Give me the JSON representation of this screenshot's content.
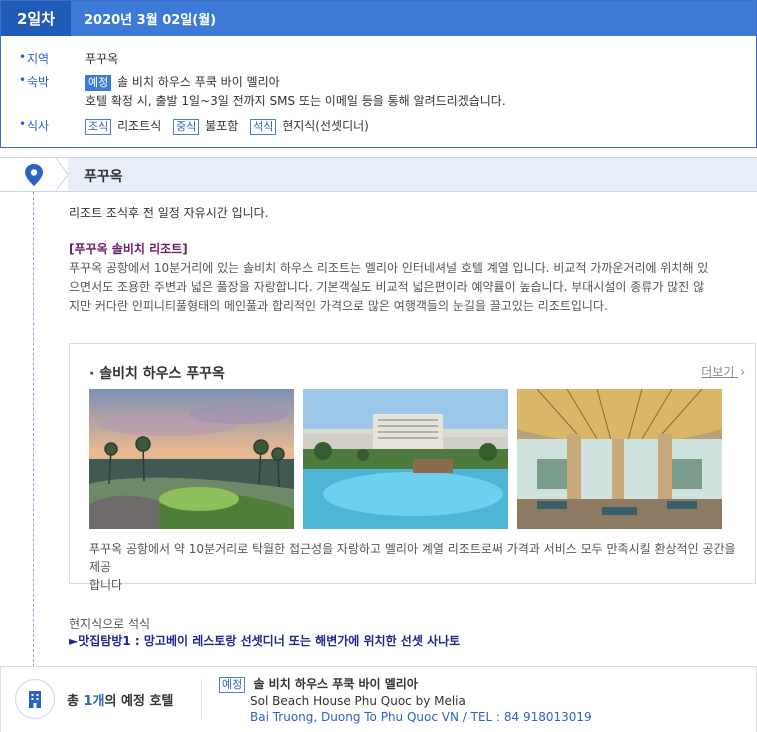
{
  "day": {
    "badge": "2일차",
    "date": "2020년 3월 02일(월)",
    "region_label": "지역",
    "region_value": "푸꾸옥",
    "stay_label": "숙박",
    "stay_tag": "예정",
    "stay_hotel": "솔 비치 하우스 푸쿡 바이 멜리아",
    "stay_note": "호텔 확정 시, 출발 1일~3일 전까지 SMS 또는 이메일 등을 통해 알려드리겠습니다.",
    "meal_label": "식사",
    "meals": [
      {
        "tag": "조식",
        "value": "리조트식"
      },
      {
        "tag": "중식",
        "value": "불포함"
      },
      {
        "tag": "석식",
        "value": "현지식(선셋디너)"
      }
    ]
  },
  "location": {
    "name": "푸꾸옥"
  },
  "schedule": {
    "free_time": "리조트 조식후 전 일정 자유시간 입니다.",
    "resort_title": "[푸꾸옥 솔비치 리조트]",
    "resort_desc_lines": [
      "푸꾸옥 공항에서 10분거리에 있는 솔비치 하우스 리조트는 멜리아 인터네셔널 호텔 계열 입니다. 비교적 가까운거리에 위치해 있",
      "으면서도 조용한 주변과 넓은 풀장을 자랑합니다. 기본객실도 비교적 넓은편이라 예약률이 높습니다. 부대시설이 종류가 많진 않",
      "지만 커다란 인피니티풀형태의 메인풀과 합리적인 가격으로 많은 여행객들의 눈길을 끌고있는 리조트입니다."
    ]
  },
  "hotel_card": {
    "title": "· 솔비치 하우스 푸꾸옥",
    "more": "더보기",
    "photos": [
      {
        "icon": "resort-sunset-photo"
      },
      {
        "icon": "resort-pool-photo"
      },
      {
        "icon": "resort-lobby-photo"
      }
    ],
    "desc_lines": [
      "푸꾸옥 공항에서 약 10분거리로 탁월한 접근성을 자랑하고 멜리아 계열 리조트로써 가격과 서비스 모두 만족시킬 환상적인 공간을 제공",
      "합니다"
    ]
  },
  "dinner": {
    "label": "현지식으로 석식",
    "link": "►맛집탐방1 : 망고베이 레스토랑 선셋디너 또는 해변가에 위치한 선셋 사나토"
  },
  "total": {
    "prefix": "총 ",
    "count": "1개",
    "suffix": "의 예정 호텔",
    "tag": "예정",
    "hotel_kr": "솔 비치 하우스 푸쿡 바이 멜리아",
    "hotel_en": "Sol Beach House Phu Quoc by Melia",
    "address": "Bai Truong, Duong To Phu Quoc VN / TEL : 84 918013019"
  },
  "colors": {
    "accent": "#3d79d6",
    "accent_dark": "#1f5bb7",
    "title_purple": "#6b1e63",
    "link_navy": "#1a2a8c"
  }
}
